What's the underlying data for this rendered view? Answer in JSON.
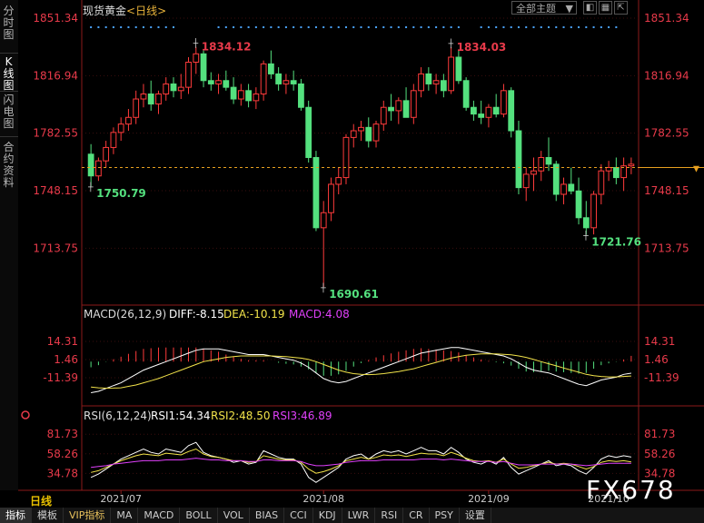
{
  "header": {
    "instrument": "现货黄金",
    "period": "<日线>",
    "theme_select": "全部主题",
    "window_buttons": [
      "restore-icon",
      "layout-icon",
      "popout-icon"
    ]
  },
  "side_tabs": [
    "分时图",
    "K线图",
    "闪电图",
    "合约资料"
  ],
  "side_tab_active": 1,
  "price_axis_labels": [
    "1851.34",
    "1816.94",
    "1782.55",
    "1748.15",
    "1713.75"
  ],
  "macd_header": {
    "title": "MACD(26,12,9)",
    "diff": "DIFF:-8.15",
    "dea": "DEA:-10.19",
    "macd": "MACD:4.08"
  },
  "macd_axis_labels": [
    "14.31",
    "1.46",
    "-11.39"
  ],
  "rsi_header": {
    "title": "RSI(6,12,24)",
    "rsi1": "RSI1:54.34",
    "rsi2": "RSI2:48.50",
    "rsi3": "RSI3:46.89"
  },
  "rsi_axis_labels": [
    "81.73",
    "58.26",
    "34.78"
  ],
  "date_labels": [
    "2021/07",
    "2021/08",
    "2021/09",
    "2021/10"
  ],
  "period_label": "日线",
  "toolbar": [
    "指标",
    "模板",
    "VIP指标",
    "MA",
    "MACD",
    "BOLL",
    "VOL",
    "BIAS",
    "CCI",
    "KDJ",
    "LWR",
    "RSI",
    "CR",
    "PSY",
    "设置"
  ],
  "watermark": "FX678",
  "colors": {
    "up": "#ff3b3b",
    "down": "#54e07e",
    "diff": "#ffffff",
    "dea": "#f2e34a",
    "rsi3": "#e040fb",
    "axis_text": "#e83a4a"
  },
  "chart_data": [
    {
      "type": "candlestick",
      "title": "现货黄金 <日线>",
      "ylim": [
        1690.61,
        1851.34
      ],
      "y_ticks": [
        1851.34,
        1816.94,
        1782.55,
        1748.15,
        1713.75
      ],
      "x_ticks": [
        "2021/07",
        "2021/08",
        "2021/09",
        "2021/10"
      ],
      "annotations": [
        {
          "label": "1834.12",
          "value": 1834.12,
          "kind": "high"
        },
        {
          "label": "1834.03",
          "value": 1834.03,
          "kind": "high"
        },
        {
          "label": "1750.79",
          "value": 1750.79,
          "kind": "low"
        },
        {
          "label": "1690.61",
          "value": 1690.61,
          "kind": "low"
        },
        {
          "label": "1721.76",
          "value": 1721.76,
          "kind": "low"
        }
      ],
      "current_price_line": 1762,
      "ohlc": [
        [
          1770,
          1776,
          1750.79,
          1757
        ],
        [
          1757,
          1768,
          1754,
          1766
        ],
        [
          1766,
          1778,
          1762,
          1774
        ],
        [
          1774,
          1786,
          1770,
          1783
        ],
        [
          1783,
          1792,
          1778,
          1788
        ],
        [
          1788,
          1797,
          1784,
          1792
        ],
        [
          1792,
          1808,
          1788,
          1803
        ],
        [
          1803,
          1812,
          1798,
          1806
        ],
        [
          1806,
          1814,
          1796,
          1800
        ],
        [
          1800,
          1808,
          1794,
          1806
        ],
        [
          1806,
          1816,
          1802,
          1812
        ],
        [
          1812,
          1816,
          1804,
          1808
        ],
        [
          1808,
          1818,
          1803,
          1810
        ],
        [
          1810,
          1828,
          1806,
          1825
        ],
        [
          1825,
          1834.12,
          1818,
          1830
        ],
        [
          1830,
          1832,
          1810,
          1814
        ],
        [
          1814,
          1819,
          1808,
          1812
        ],
        [
          1812,
          1818,
          1806,
          1814
        ],
        [
          1814,
          1820,
          1808,
          1810
        ],
        [
          1810,
          1816,
          1800,
          1803
        ],
        [
          1803,
          1812,
          1799,
          1808
        ],
        [
          1808,
          1812,
          1798,
          1802
        ],
        [
          1802,
          1810,
          1797,
          1806
        ],
        [
          1806,
          1826,
          1802,
          1824
        ],
        [
          1824,
          1832,
          1815,
          1818
        ],
        [
          1818,
          1822,
          1808,
          1812
        ],
        [
          1812,
          1818,
          1806,
          1814
        ],
        [
          1814,
          1820,
          1808,
          1812
        ],
        [
          1812,
          1815,
          1796,
          1798
        ],
        [
          1798,
          1802,
          1765,
          1768
        ],
        [
          1768,
          1772,
          1724,
          1726
        ],
        [
          1726,
          1742,
          1690.61,
          1735
        ],
        [
          1735,
          1756,
          1730,
          1752
        ],
        [
          1752,
          1762,
          1746,
          1756
        ],
        [
          1756,
          1782,
          1752,
          1780
        ],
        [
          1780,
          1788,
          1774,
          1784
        ],
        [
          1784,
          1790,
          1778,
          1786
        ],
        [
          1786,
          1792,
          1774,
          1778
        ],
        [
          1778,
          1790,
          1774,
          1788
        ],
        [
          1788,
          1802,
          1784,
          1798
        ],
        [
          1798,
          1806,
          1790,
          1796
        ],
        [
          1796,
          1804,
          1788,
          1802
        ],
        [
          1802,
          1810,
          1794,
          1792
        ],
        [
          1792,
          1812,
          1788,
          1808
        ],
        [
          1808,
          1822,
          1804,
          1818
        ],
        [
          1818,
          1822,
          1808,
          1812
        ],
        [
          1812,
          1818,
          1806,
          1814
        ],
        [
          1814,
          1818,
          1804,
          1808
        ],
        [
          1808,
          1834.03,
          1806,
          1828
        ],
        [
          1828,
          1832,
          1812,
          1814
        ],
        [
          1814,
          1816,
          1796,
          1798
        ],
        [
          1798,
          1802,
          1790,
          1794
        ],
        [
          1794,
          1802,
          1788,
          1792
        ],
        [
          1792,
          1800,
          1786,
          1798
        ],
        [
          1798,
          1806,
          1792,
          1794
        ],
        [
          1794,
          1812,
          1792,
          1808
        ],
        [
          1808,
          1810,
          1780,
          1784
        ],
        [
          1784,
          1790,
          1746,
          1750
        ],
        [
          1750,
          1762,
          1742,
          1758
        ],
        [
          1758,
          1768,
          1748,
          1760
        ],
        [
          1760,
          1772,
          1754,
          1768
        ],
        [
          1768,
          1780,
          1760,
          1764
        ],
        [
          1764,
          1766,
          1742,
          1746
        ],
        [
          1746,
          1756,
          1740,
          1752
        ],
        [
          1752,
          1762,
          1746,
          1748
        ],
        [
          1748,
          1756,
          1728,
          1732
        ],
        [
          1732,
          1742,
          1721.76,
          1726
        ],
        [
          1726,
          1748,
          1722,
          1746
        ],
        [
          1746,
          1764,
          1740,
          1760
        ],
        [
          1760,
          1766,
          1754,
          1762
        ],
        [
          1762,
          1768,
          1752,
          1756
        ],
        [
          1756,
          1768,
          1748,
          1763
        ],
        [
          1763,
          1768,
          1758,
          1764
        ]
      ],
      "xlabel": "",
      "ylabel": ""
    },
    {
      "type": "bar",
      "title": "MACD(26,12,9)",
      "ylim": [
        -24.24,
        27.16
      ],
      "y_ticks": [
        14.31,
        1.46,
        -11.39
      ],
      "series": [
        {
          "name": "DIFF",
          "values": [
            -22,
            -21,
            -19,
            -17,
            -15,
            -12,
            -9,
            -6,
            -4,
            -2,
            0,
            2,
            4,
            6,
            8,
            9,
            9,
            9,
            8,
            7,
            6,
            5,
            5,
            5,
            4,
            3,
            2,
            1,
            -1,
            -4,
            -8,
            -12,
            -14,
            -15,
            -14,
            -12,
            -10,
            -8,
            -6,
            -4,
            -2,
            0,
            2,
            4,
            6,
            7,
            8,
            9,
            10,
            10,
            9,
            8,
            7,
            6,
            5,
            4,
            2,
            -1,
            -4,
            -6,
            -7,
            -8,
            -10,
            -12,
            -14,
            -16,
            -17,
            -15,
            -13,
            -12,
            -11,
            -9,
            -8.15
          ]
        },
        {
          "name": "DEA",
          "values": [
            -18,
            -18.5,
            -18.8,
            -18.7,
            -18.5,
            -17.5,
            -16.5,
            -15,
            -13.5,
            -12,
            -10,
            -8,
            -6,
            -4,
            -2,
            0,
            1,
            2,
            3,
            3.5,
            4,
            4,
            4,
            4,
            4,
            3.8,
            3.5,
            3,
            2.5,
            1.5,
            0,
            -2,
            -4,
            -6,
            -7.5,
            -8.5,
            -9,
            -9.2,
            -9,
            -8.5,
            -7.8,
            -7,
            -6,
            -5,
            -3.5,
            -2,
            -0.5,
            1,
            2.5,
            3.5,
            4.5,
            5,
            5.5,
            5.5,
            5.5,
            5.2,
            4.8,
            4,
            3,
            1.5,
            0,
            -1.5,
            -3,
            -4.5,
            -6,
            -7.5,
            -9,
            -10,
            -10.5,
            -10.8,
            -10.8,
            -10.5,
            -10.19
          ]
        },
        {
          "name": "MACD",
          "values": [
            -4,
            -2.5,
            -0.2,
            1.7,
            3.5,
            5.5,
            7.5,
            9,
            9.5,
            10,
            10,
            10,
            10,
            10,
            10,
            9,
            8,
            7,
            5,
            3.5,
            2,
            1,
            1,
            1,
            0,
            -0.8,
            -1.5,
            -2,
            -3.5,
            -5.5,
            -8,
            -10,
            -10,
            -9,
            -6.5,
            -3.5,
            -1,
            1.2,
            3,
            4.5,
            5.8,
            7,
            8,
            9,
            9.5,
            9,
            8.5,
            8,
            7.5,
            6.5,
            4.5,
            3,
            1.5,
            0.5,
            -0.5,
            -1.2,
            -2.8,
            -5,
            -7,
            -7.5,
            -7,
            -6.5,
            -7,
            -7.5,
            -8,
            -8.5,
            -8,
            -5,
            -2.5,
            -1.2,
            -0.2,
            1.5,
            4.08
          ]
        }
      ],
      "xlabel": "",
      "ylabel": ""
    },
    {
      "type": "line",
      "title": "RSI(6,12,24)",
      "ylim": [
        20,
        95
      ],
      "y_ticks": [
        81.73,
        58.26,
        34.78
      ],
      "series": [
        {
          "name": "RSI1",
          "values": [
            30,
            34,
            40,
            46,
            52,
            56,
            60,
            64,
            60,
            58,
            64,
            62,
            60,
            68,
            72,
            60,
            56,
            54,
            52,
            48,
            50,
            46,
            48,
            62,
            58,
            54,
            52,
            52,
            46,
            30,
            24,
            30,
            36,
            42,
            52,
            56,
            58,
            52,
            58,
            62,
            60,
            62,
            58,
            62,
            66,
            62,
            62,
            58,
            66,
            60,
            52,
            48,
            46,
            50,
            46,
            54,
            42,
            34,
            38,
            42,
            46,
            50,
            44,
            46,
            44,
            38,
            34,
            42,
            52,
            56,
            54,
            56,
            54.34
          ]
        },
        {
          "name": "RSI2",
          "values": [
            36,
            38,
            42,
            46,
            50,
            53,
            56,
            58,
            57,
            56,
            59,
            58,
            57,
            61,
            64,
            58,
            55,
            54,
            52,
            50,
            50,
            48,
            49,
            56,
            54,
            52,
            51,
            51,
            48,
            40,
            35,
            37,
            40,
            44,
            50,
            52,
            54,
            52,
            54,
            57,
            56,
            57,
            55,
            57,
            59,
            58,
            58,
            56,
            60,
            57,
            53,
            50,
            49,
            50,
            48,
            52,
            46,
            41,
            42,
            44,
            46,
            48,
            46,
            47,
            46,
            43,
            40,
            43,
            48,
            50,
            49,
            50,
            48.5
          ]
        },
        {
          "name": "RSI3",
          "values": [
            42,
            43,
            44,
            46,
            47,
            48,
            49,
            50,
            50,
            50,
            51,
            51,
            51,
            52,
            53,
            52,
            51,
            51,
            50,
            50,
            50,
            49,
            49,
            51,
            51,
            50,
            50,
            50,
            49,
            46,
            44,
            44,
            45,
            46,
            48,
            49,
            50,
            50,
            50,
            51,
            51,
            51,
            51,
            51,
            52,
            52,
            52,
            51,
            52,
            51,
            50,
            49,
            49,
            49,
            48,
            49,
            47,
            45,
            45,
            45,
            46,
            46,
            46,
            46,
            46,
            45,
            44,
            45,
            46,
            47,
            47,
            47,
            46.89
          ]
        }
      ],
      "xlabel": "",
      "ylabel": ""
    }
  ]
}
